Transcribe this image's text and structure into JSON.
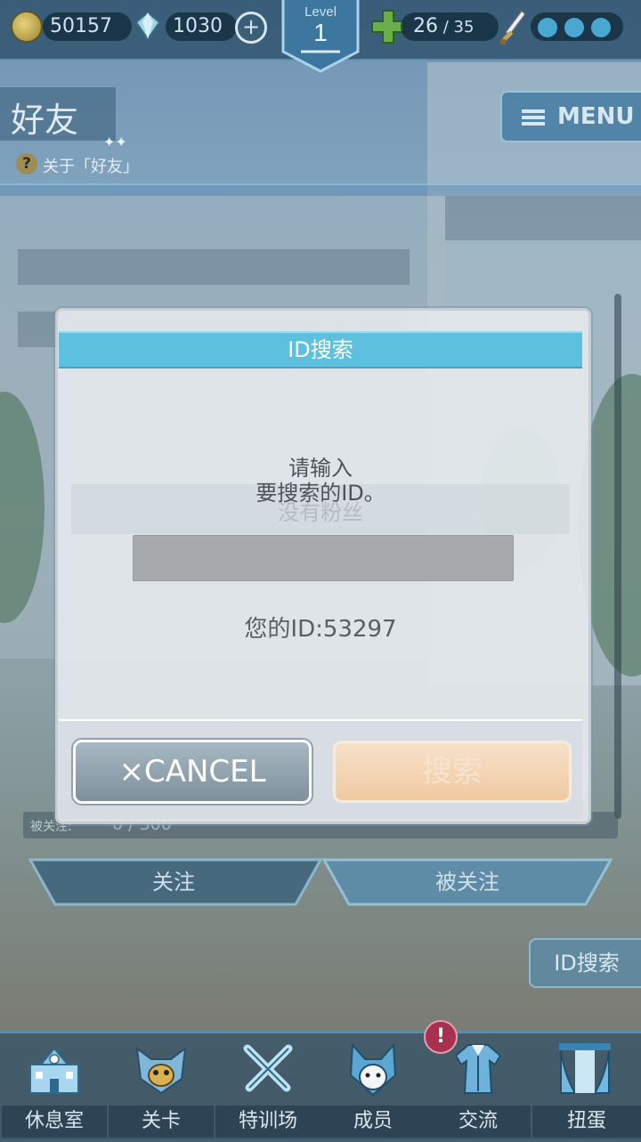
{
  "topbar": {
    "coins": "50157",
    "gems": "1030",
    "add_icon": "plus-circle-icon",
    "level_label": "Level",
    "level_value": "1",
    "stamina_current": "26",
    "stamina_sep": " / ",
    "stamina_max": "35"
  },
  "header": {
    "title": "好友",
    "about_link": "关于「好友」",
    "menu_label": "MENU"
  },
  "background": {
    "empty_notice": "没有粉丝",
    "follower_count_label": "被关注:",
    "follower_count_value": "0 / 300"
  },
  "tabs": [
    {
      "label": "关注"
    },
    {
      "label": "被关注"
    }
  ],
  "id_search_button": "ID搜索",
  "dialog": {
    "title": "ID搜索",
    "prompt_line1": "请输入",
    "prompt_line2": "要搜索的ID。",
    "input_value": "",
    "your_id": "您的ID:53297",
    "cancel_label": "×CANCEL",
    "search_label": "搜索"
  },
  "nav": [
    {
      "label": "休息室",
      "icon": "school-building-icon"
    },
    {
      "label": "关卡",
      "icon": "demon-mask-icon"
    },
    {
      "label": "特训场",
      "icon": "crossed-swords-icon"
    },
    {
      "label": "成员",
      "icon": "cat-eared-character-icon"
    },
    {
      "label": "交流",
      "icon": "school-uniform-icon"
    },
    {
      "label": "扭蛋",
      "icon": "curtain-stage-icon"
    }
  ],
  "notification_badge": "!",
  "colors": {
    "dialog_header": "#5cc0de",
    "cancel_button": "#8a9ca8",
    "search_button_disabled": "#f1cda8",
    "badge": "#a9304f"
  }
}
